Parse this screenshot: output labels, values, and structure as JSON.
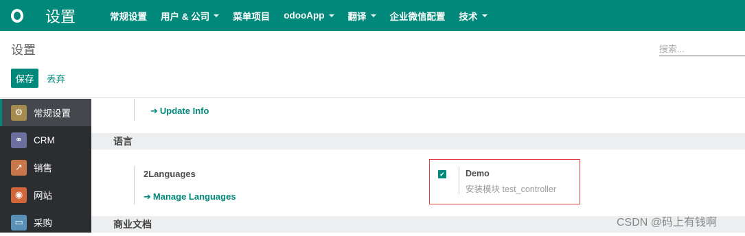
{
  "topbar": {
    "logo": "O",
    "app_title": "设置",
    "menu": [
      {
        "label": "常规设置",
        "dropdown": false
      },
      {
        "label": "用户 & 公司",
        "dropdown": true
      },
      {
        "label": "菜单项目",
        "dropdown": false
      },
      {
        "label": "odooApp",
        "dropdown": true
      },
      {
        "label": "翻译",
        "dropdown": true
      },
      {
        "label": "企业微信配置",
        "dropdown": false
      },
      {
        "label": "技术",
        "dropdown": true
      }
    ]
  },
  "control_panel": {
    "breadcrumb": "设置",
    "search_placeholder": "搜索...",
    "save_label": "保存",
    "discard_label": "丢弃"
  },
  "sidebar": {
    "items": [
      {
        "label": "常规设置",
        "icon": "gear-icon",
        "icon_color": "#a68b4e",
        "active": true
      },
      {
        "label": "CRM",
        "icon": "handshake-icon",
        "icon_color": "#6a6f9e",
        "active": false
      },
      {
        "label": "销售",
        "icon": "chart-icon",
        "icon_color": "#c8764a",
        "active": false
      },
      {
        "label": "网站",
        "icon": "globe-icon",
        "icon_color": "#d1663b",
        "active": false
      },
      {
        "label": "采购",
        "icon": "card-icon",
        "icon_color": "#5a8fb8",
        "active": false
      }
    ]
  },
  "main": {
    "update_info_link": "Update Info",
    "section_language": "语言",
    "languages_title": "2Languages",
    "manage_languages_link": "Manage Languages",
    "demo": {
      "title": "Demo",
      "subtitle": "安装模块 test_controller",
      "checked": true
    },
    "section_business_docs": "商业文档"
  },
  "watermark": "CSDN @码上有钱啊",
  "colors": {
    "primary": "#00897b",
    "sidebar_bg": "#2c2d30",
    "highlight_border": "#e03d3d"
  }
}
